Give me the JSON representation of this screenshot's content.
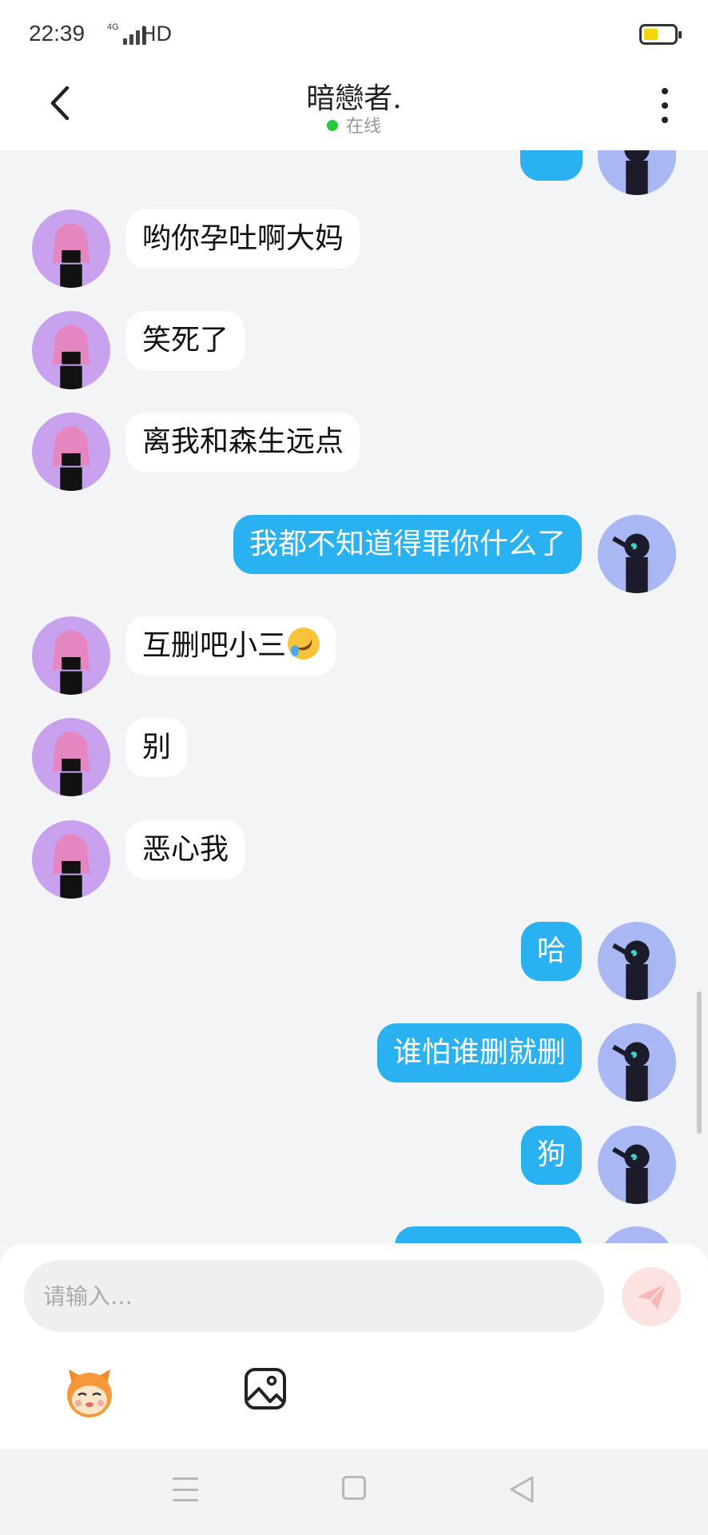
{
  "status_bar": {
    "time": "22:39",
    "network": "4G",
    "hd": "HD",
    "battery_level": 0.4
  },
  "header": {
    "title": "暗戀者.",
    "status": "在线"
  },
  "messages": [
    {
      "side": "in",
      "text": "哟你孕吐啊大妈"
    },
    {
      "side": "in",
      "text": "笑死了"
    },
    {
      "side": "in",
      "text": "离我和森生远点"
    },
    {
      "side": "out",
      "text": "我都不知道得罪你什么了"
    },
    {
      "side": "in",
      "text": "互删吧小三",
      "emoji": "rolling-on-floor-laughing"
    },
    {
      "side": "in",
      "text": "别"
    },
    {
      "side": "in",
      "text": "恶心我"
    },
    {
      "side": "out",
      "text": "哈"
    },
    {
      "side": "out",
      "text": "谁怕谁删就删"
    },
    {
      "side": "out",
      "text": "狗"
    }
  ],
  "input": {
    "placeholder": "请输入…"
  },
  "colors": {
    "outgoing_bubble": "#29b1f2",
    "incoming_bubble": "#ffffff",
    "background": "#f3f4f6",
    "online": "#27c93f"
  }
}
